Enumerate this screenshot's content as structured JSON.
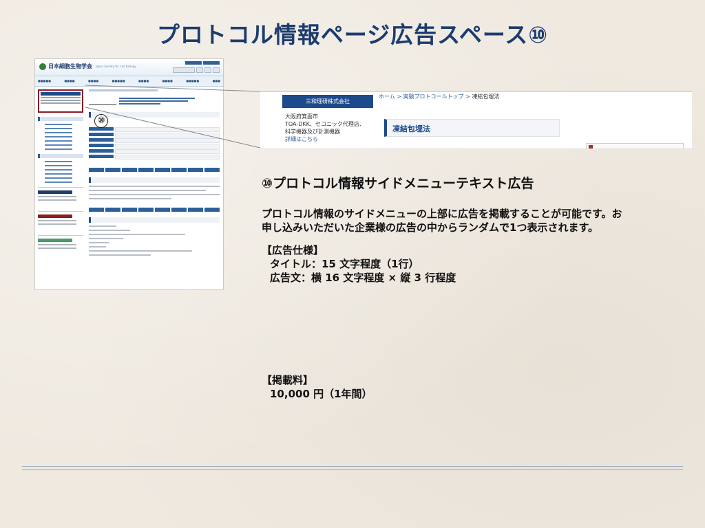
{
  "slide": {
    "title": "プロトコル情報ページ広告スペース⑩"
  },
  "screenshot": {
    "site_name": "日本細胞生物学会",
    "site_name_en": "Japan Society for Cell Biology",
    "circle_label": "⑩"
  },
  "zoom": {
    "company_button": "三和理研株式会社",
    "info_lines": [
      "大阪府箕面市",
      "TOA-DKK、セコニック代理店、",
      "科学機器及び計測機器"
    ],
    "detail_link": "詳細はこちら",
    "breadcrumb": [
      "ホーム",
      ">",
      "実験プロトコールトップ",
      ">",
      "凍結包埋法"
    ],
    "section_title": "凍結包埋法"
  },
  "description": {
    "heading": "⑩プロトコル情報サイドメニューテキスト広告",
    "body_line1": "プロトコル情報のサイドメニューの上部に広告を掲載することが可能です。お",
    "body_line2": "申し込みいただいた企業様の広告の中からランダムで1つ表示されます。",
    "spec_heading": "【広告仕様】",
    "spec_title": "タイトル：15 文字程度（1行）",
    "spec_body": "広告文：横 16 文字程度 × 縦 3 行程度",
    "fee_heading": "【掲載料】",
    "fee_value": "10,000 円（1年間）"
  },
  "colors": {
    "title": "#1c3c6e",
    "accent_blue": "#1d4a8a",
    "highlight_red": "#8b1c23",
    "background": "#efe9e0"
  }
}
